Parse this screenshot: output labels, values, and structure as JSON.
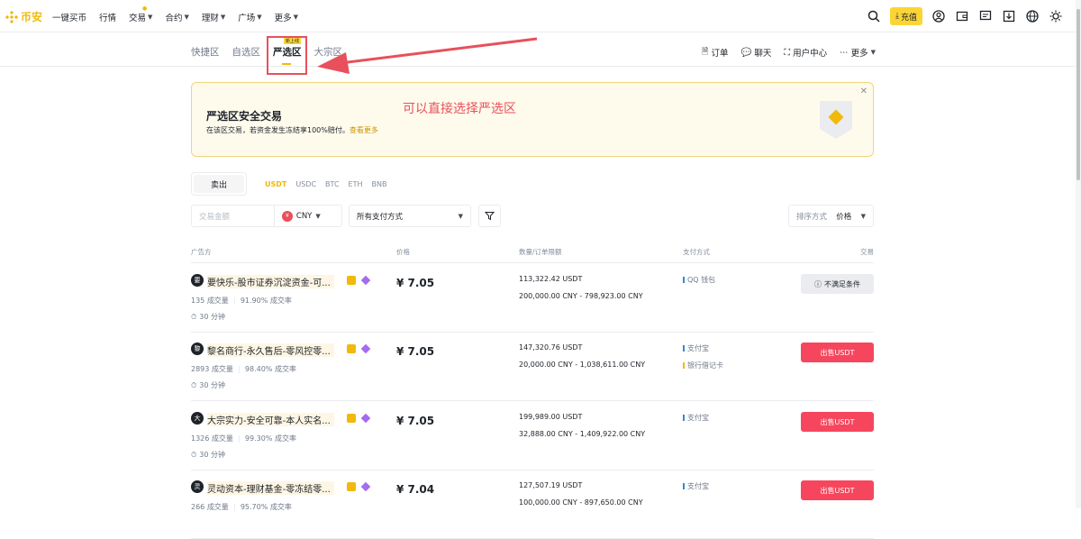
{
  "header": {
    "logo_text": "币安",
    "nav": [
      "一键买币",
      "行情",
      "交易",
      "合约",
      "理财",
      "广场",
      "更多"
    ],
    "deposit_label": "充值"
  },
  "subnav": {
    "tabs": [
      "快捷区",
      "自选区",
      "严选区",
      "大宗区"
    ],
    "badge": "新上线",
    "right": [
      "订单",
      "聊天",
      "用户中心",
      "更多"
    ]
  },
  "banner": {
    "title": "严选区安全交易",
    "desc": "在该区交易，若资金发生冻结享100%赔付。",
    "link": "查看更多"
  },
  "annotation": "可以直接选择严选区",
  "trade": {
    "sell_tab": "卖出",
    "coins": [
      "USDT",
      "USDC",
      "BTC",
      "ETH",
      "BNB"
    ],
    "amount_placeholder": "交易金额",
    "currency": "CNY",
    "currency_icon": "¥",
    "payment": "所有支付方式",
    "sort_label": "排序方式",
    "sort_value": "价格"
  },
  "table": {
    "headers": [
      "广告方",
      "价格",
      "数量/订单限额",
      "支付方式",
      "交易"
    ],
    "rows": [
      {
        "avatar": "要",
        "name": "要快乐-股市证券沉淀资金-可...",
        "orders": "135 成交量",
        "rate": "91.90% 成交率",
        "time": "30 分钟",
        "price": "¥ 7.05",
        "qty": "113,322.42 USDT",
        "limit": "200,000.00 CNY - 798,923.00 CNY",
        "pay": [
          "QQ 钱包"
        ],
        "action": "不满足条件",
        "action_type": "grey"
      },
      {
        "avatar": "黎",
        "name": "黎名商行-永久售后-零风控零...",
        "orders": "2893 成交量",
        "rate": "98.40% 成交率",
        "time": "30 分钟",
        "price": "¥ 7.05",
        "qty": "147,320.76 USDT",
        "limit": "20,000.00 CNY - 1,038,611.00 CNY",
        "pay": [
          "支付宝",
          "银行借记卡"
        ],
        "action": "出售USDT",
        "action_type": "sell"
      },
      {
        "avatar": "大",
        "name": "大宗实力-安全可靠-本人实名...",
        "orders": "1326 成交量",
        "rate": "99.30% 成交率",
        "time": "30 分钟",
        "price": "¥ 7.05",
        "qty": "199,989.00 USDT",
        "limit": "32,888.00 CNY - 1,409,922.00 CNY",
        "pay": [
          "支付宝"
        ],
        "action": "出售USDT",
        "action_type": "sell"
      },
      {
        "avatar": "灵",
        "name": "灵动资本-理财基金-零冻结零...",
        "orders": "266 成交量",
        "rate": "95.70% 成交率",
        "time": "",
        "price": "¥ 7.04",
        "qty": "127,507.19 USDT",
        "limit": "100,000.00 CNY - 897,650.00 CNY",
        "pay": [
          "支付宝"
        ],
        "action": "出售USDT",
        "action_type": "sell"
      }
    ]
  },
  "colors": {
    "accent": "#f0b90b",
    "sell": "#f6465d",
    "annotation": "#e8505b",
    "pay_blue": "#2e8ad8",
    "pay_orange": "#f0b90b"
  }
}
